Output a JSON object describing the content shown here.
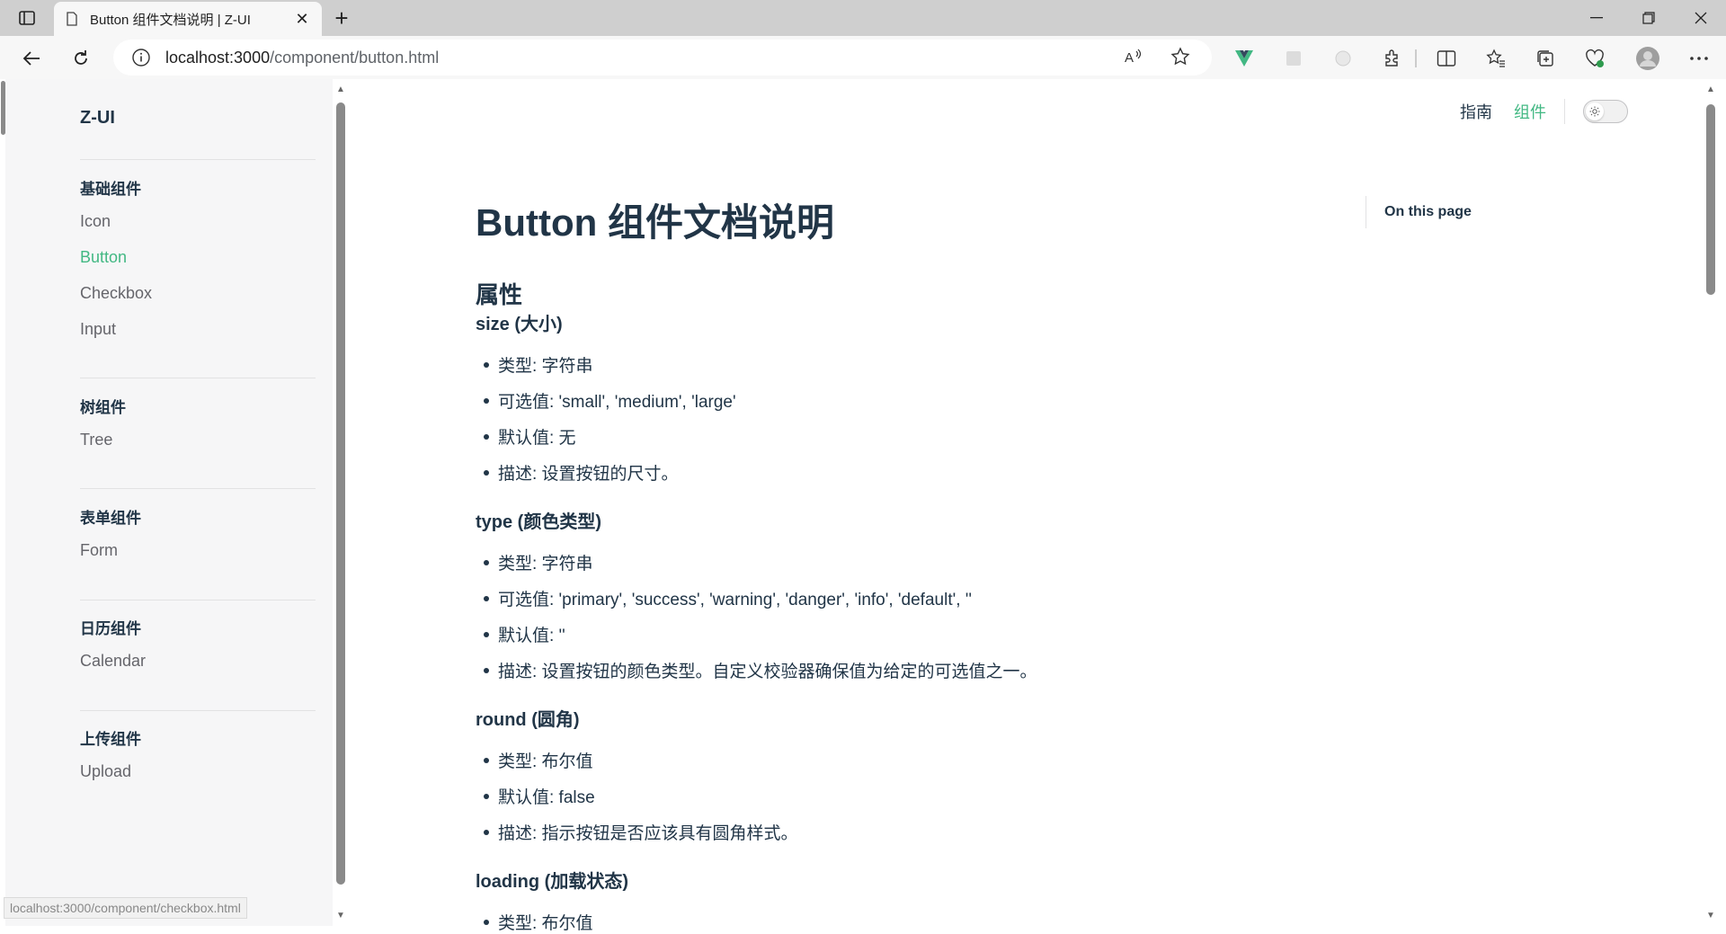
{
  "browser": {
    "tab_title": "Button 组件文档说明 | Z-UI",
    "url_host": "localhost:3000",
    "url_path": "/component/button.html"
  },
  "status_url": "localhost:3000/component/checkbox.html",
  "site": {
    "brand": "Z-UI",
    "nav_links": [
      "指南",
      "组件"
    ],
    "active_link": "组件"
  },
  "sidebar": {
    "groups": [
      {
        "title": "基础组件",
        "items": [
          "Icon",
          "Button",
          "Checkbox",
          "Input"
        ]
      },
      {
        "title": "树组件",
        "items": [
          "Tree"
        ]
      },
      {
        "title": "表单组件",
        "items": [
          "Form"
        ]
      },
      {
        "title": "日历组件",
        "items": [
          "Calendar"
        ]
      },
      {
        "title": "上传组件",
        "items": [
          "Upload"
        ]
      }
    ],
    "active_item": "Button"
  },
  "outline": {
    "title": "On this page"
  },
  "doc": {
    "title": "Button 组件文档说明",
    "section": "属性",
    "props": [
      {
        "heading": "size (大小)",
        "bullets": [
          "类型: 字符串",
          "可选值: 'small', 'medium', 'large'",
          "默认值: 无",
          "描述: 设置按钮的尺寸。"
        ]
      },
      {
        "heading": "type (颜色类型)",
        "bullets": [
          "类型: 字符串",
          "可选值: 'primary', 'success', 'warning', 'danger', 'info', 'default', ''",
          "默认值: ''",
          "描述: 设置按钮的颜色类型。自定义校验器确保值为给定的可选值之一。"
        ]
      },
      {
        "heading": "round (圆角)",
        "bullets": [
          "类型: 布尔值",
          "默认值: false",
          "描述: 指示按钮是否应该具有圆角样式。"
        ]
      },
      {
        "heading": "loading (加载状态)",
        "bullets": [
          "类型: 布尔值"
        ]
      }
    ]
  },
  "colors": {
    "accent": "#42b883",
    "text": "#213547",
    "sidebar_bg": "#f6f6f7"
  }
}
